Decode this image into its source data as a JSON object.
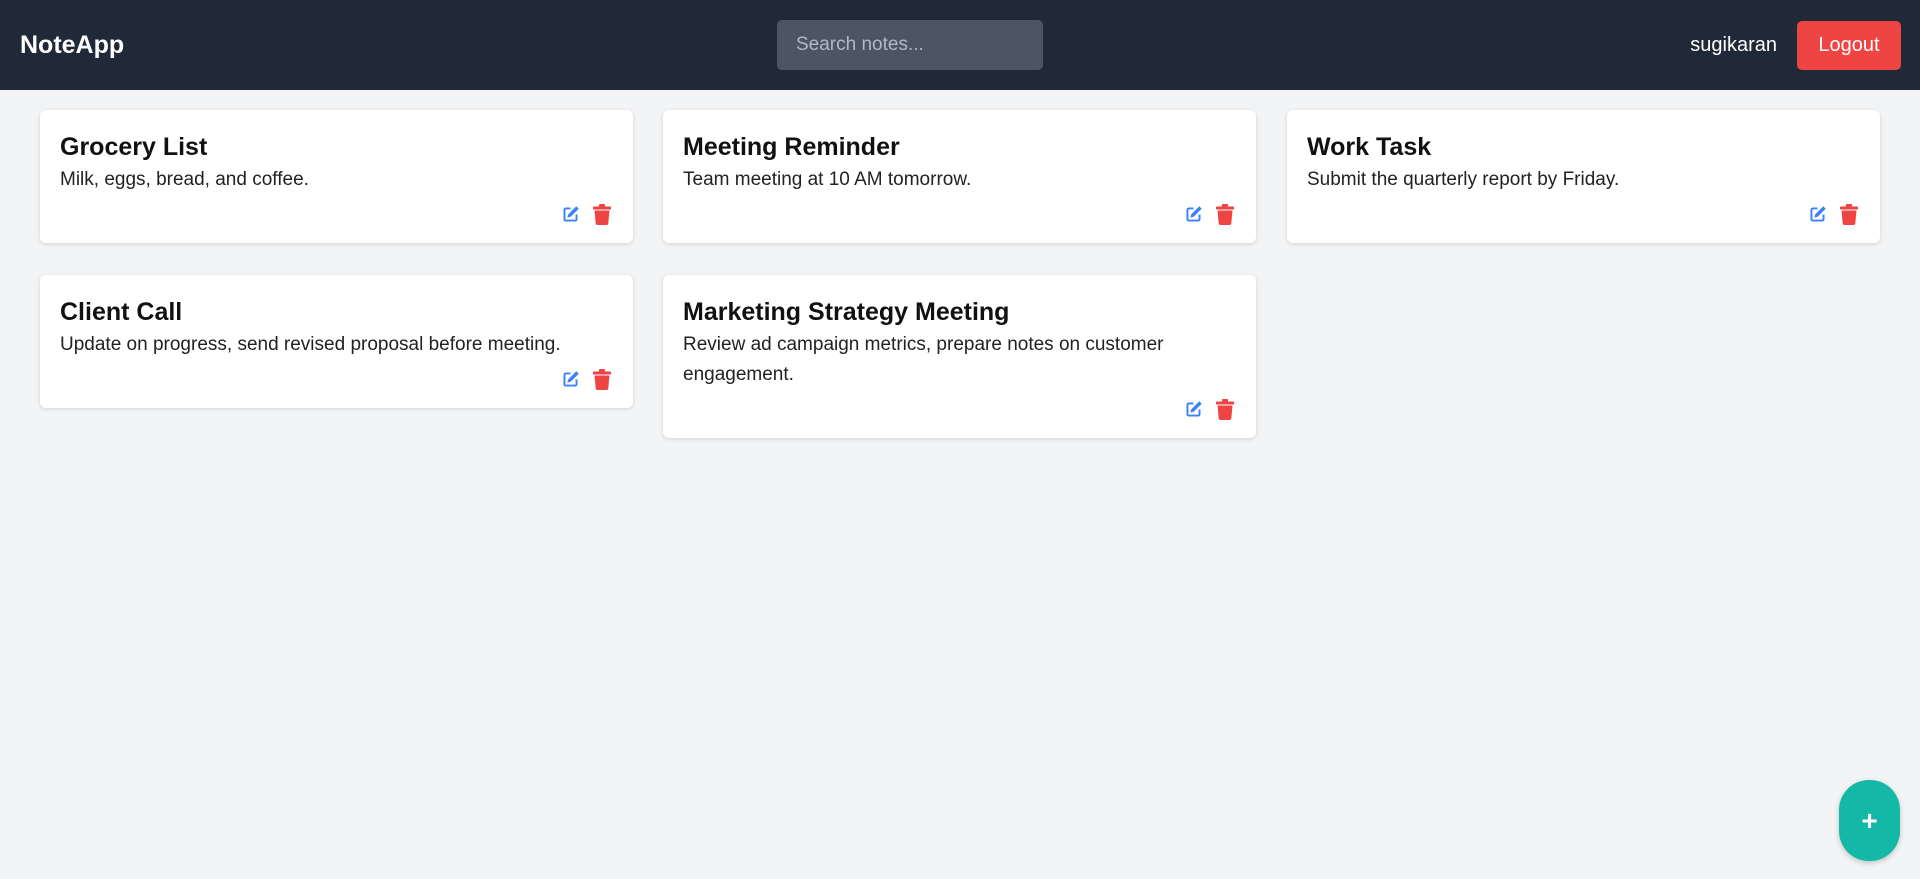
{
  "navbar": {
    "brand": "NoteApp",
    "search_placeholder": "Search notes...",
    "search_value": "",
    "username": "sugikaran",
    "logout_label": "Logout"
  },
  "colors": {
    "navbar_bg": "#1f2937",
    "page_bg": "#f3f4f6",
    "edit_icon": "#3b82f6",
    "delete_icon": "#ef4444",
    "logout_bg": "#ef4444",
    "fab_bg": "#14b8a6"
  },
  "notes": [
    {
      "title": "Grocery List",
      "body": "Milk, eggs, bread, and coffee.",
      "edit_icon": "edit-icon",
      "delete_icon": "trash-icon"
    },
    {
      "title": "Meeting Reminder",
      "body": "Team meeting at 10 AM tomorrow.",
      "edit_icon": "edit-icon",
      "delete_icon": "trash-icon"
    },
    {
      "title": "Work Task",
      "body": "Submit the quarterly report by Friday.",
      "edit_icon": "edit-icon",
      "delete_icon": "trash-icon"
    },
    {
      "title": "Client Call",
      "body": "Update on progress, send revised proposal before meeting.",
      "edit_icon": "edit-icon",
      "delete_icon": "trash-icon"
    },
    {
      "title": "Marketing Strategy Meeting",
      "body": "Review ad campaign metrics, prepare notes on customer engagement.",
      "edit_icon": "edit-icon",
      "delete_icon": "trash-icon"
    }
  ],
  "fab": {
    "label": "+"
  }
}
